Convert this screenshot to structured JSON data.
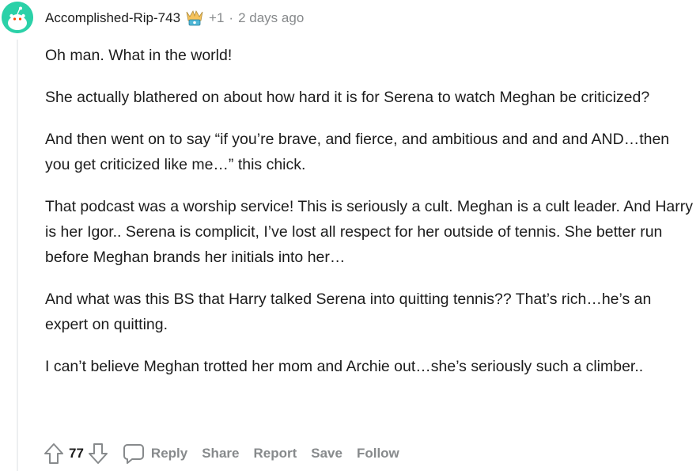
{
  "comment": {
    "username": "Accomplished-Rip-743",
    "award_count": "+1",
    "separator": "·",
    "timestamp": "2 days ago",
    "paragraphs": [
      "Oh man. What in the world!",
      "She actually blathered on about how hard it is for Serena to watch Meghan be criticized?",
      "And then went on to say “if you’re brave, and fierce, and ambitious and and and AND…then you get criticized like me…” this chick.",
      "That podcast was a worship service! This is seriously a cult. Meghan is a cult leader. And Harry is her Igor.. Serena is complicit, I’ve lost all respect for her outside of tennis. She better run before Meghan brands her initials into her…",
      "And what was this BS that Harry talked Serena into quitting tennis?? That’s rich…he’s an expert on quitting.",
      "I can’t believe Meghan trotted her mom and Archie out…she’s seriously such a climber.."
    ],
    "score": "77",
    "actions": {
      "reply": "Reply",
      "share": "Share",
      "report": "Report",
      "save": "Save",
      "follow": "Follow"
    }
  },
  "colors": {
    "avatar_bg": "#2bd1a8",
    "meta_text": "#878a8c",
    "body_text": "#1c1c1c",
    "thread_line": "#edeff1"
  },
  "icons": [
    "snoo-avatar-icon",
    "award-flair-icon",
    "upvote-icon",
    "downvote-icon",
    "reply-icon"
  ]
}
